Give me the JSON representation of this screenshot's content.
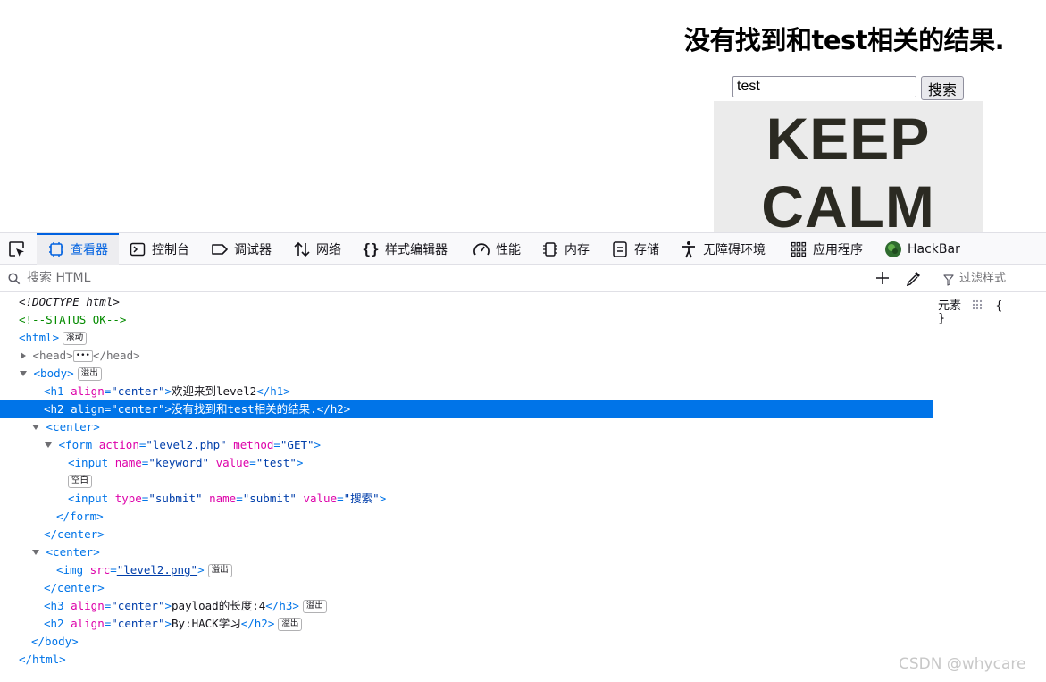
{
  "page": {
    "heading": "没有找到和test相关的结果.",
    "keyword_value": "test",
    "search_button": "搜索",
    "image_text_line1": "KEEP",
    "image_text_line2": "CALM"
  },
  "devtools": {
    "tabs": [
      {
        "label": "查看器",
        "icon": "inspector-icon",
        "selected": true
      },
      {
        "label": "控制台",
        "icon": "console-icon"
      },
      {
        "label": "调试器",
        "icon": "debugger-icon"
      },
      {
        "label": "网络",
        "icon": "network-icon"
      },
      {
        "label": "样式编辑器",
        "icon": "style-editor-icon"
      },
      {
        "label": "性能",
        "icon": "performance-icon"
      },
      {
        "label": "内存",
        "icon": "memory-icon"
      },
      {
        "label": "存储",
        "icon": "storage-icon"
      },
      {
        "label": "无障碍环境",
        "icon": "accessibility-icon"
      },
      {
        "label": "应用程序",
        "icon": "application-icon"
      },
      {
        "label": "HackBar",
        "icon": "hackbar-icon"
      }
    ],
    "search_placeholder": "搜索 HTML",
    "filter_placeholder": "过滤样式",
    "rules": {
      "selector": "元素",
      "open_brace": "{",
      "close_brace": "}"
    },
    "markup": {
      "doctype": "<!DOCTYPE html>",
      "comment": "<!--STATUS OK-->",
      "badge_scroll": "滚动",
      "badge_overflow": "溢出",
      "badge_whitespace": "空白",
      "h1_text": "欢迎来到level2",
      "h2_text": "没有找到和test相关的结果.",
      "form_action": "\"level2.php\"",
      "form_method": "\"GET\"",
      "input_name": "\"keyword\"",
      "input_value": "\"test\"",
      "submit_type": "\"submit\"",
      "submit_name": "\"submit\"",
      "submit_value": "\"搜索\"",
      "img_src": "\"level2.png\"",
      "h3_text": "payload的长度:4",
      "h2b_text": "By:HACK学习",
      "center_value": "\"center\""
    }
  },
  "watermark": "CSDN @whycare"
}
